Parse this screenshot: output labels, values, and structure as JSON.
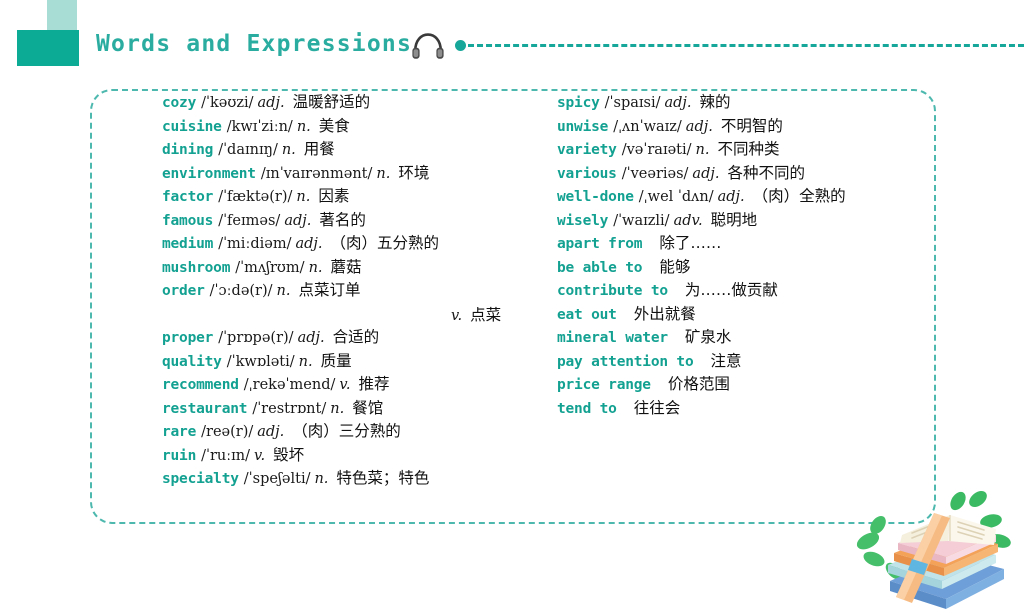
{
  "header": {
    "title": "Words and Expressions",
    "audio_icon": "headphone-icon",
    "accent_color": "#0bab96",
    "accent_light_color": "#a8ddd5",
    "title_color": "#2aada0",
    "trail_color": "#16a79a"
  },
  "panel": {
    "border_color": "#4cb8ae",
    "border_style": "dashed"
  },
  "word_color": "#13a192",
  "columns": {
    "left": [
      {
        "word": "cozy",
        "ipa": "/ˈkəʊzi/",
        "pos": "adj.",
        "cn": "温暖舒适的"
      },
      {
        "word": "cuisine",
        "ipa": "/kwɪˈziːn/",
        "pos": "n.",
        "cn": "美食"
      },
      {
        "word": "dining",
        "ipa": "/ˈdaɪnɪŋ/",
        "pos": "n.",
        "cn": "用餐"
      },
      {
        "word": "environment",
        "ipa": "/ɪnˈvaɪrənmənt/",
        "pos": "n.",
        "cn": "环境"
      },
      {
        "word": "factor",
        "ipa": "/ˈfæktə(r)/",
        "pos": "n.",
        "cn": "因素"
      },
      {
        "word": "famous",
        "ipa": "/ˈfeɪməs/",
        "pos": "adj.",
        "cn": "著名的"
      },
      {
        "word": "medium",
        "ipa": "/ˈmiːdiəm/",
        "pos": "adj.",
        "cn": "（肉）五分熟的"
      },
      {
        "word": "mushroom",
        "ipa": "/ˈmʌʃrʊm/",
        "pos": "n.",
        "cn": "蘑菇"
      },
      {
        "word": "order",
        "ipa": "/ˈɔːdə(r)/",
        "pos": "n.",
        "cn": "点菜订单"
      },
      {
        "word": "",
        "ipa": "",
        "pos": "",
        "cn": ""
      },
      {
        "word": "proper",
        "ipa": "/ˈprɒpə(r)/",
        "pos": "adj.",
        "cn": "合适的"
      },
      {
        "word": "quality",
        "ipa": "/ˈkwɒləti/",
        "pos": "n.",
        "cn": "质量"
      },
      {
        "word": "recommend",
        "ipa": "/ˌrekəˈmend/",
        "pos": "v.",
        "cn": "推荐"
      },
      {
        "word": "restaurant",
        "ipa": "/ˈrestrɒnt/",
        "pos": "n.",
        "cn": "餐馆"
      },
      {
        "word": "rare",
        "ipa": "/reə(r)/",
        "pos": "adj.",
        "cn": "（肉）三分熟的"
      },
      {
        "word": "ruin",
        "ipa": "/ˈruːɪn/",
        "pos": "v.",
        "cn": "毁坏"
      },
      {
        "word": "specialty",
        "ipa": "/ˈspeʃəlti/",
        "pos": "n.",
        "cn": "特色菜；特色"
      }
    ],
    "right": [
      {
        "word": "spicy",
        "ipa": "/ˈspaɪsi/",
        "pos": "adj.",
        "cn": "辣的"
      },
      {
        "word": "unwise",
        "ipa": "/ˌʌnˈwaɪz/",
        "pos": "adj.",
        "cn": "不明智的"
      },
      {
        "word": "variety",
        "ipa": "/vəˈraɪəti/",
        "pos": "n.",
        "cn": "不同种类"
      },
      {
        "word": "various",
        "ipa": "/ˈveəriəs/",
        "pos": "adj.",
        "cn": "各种不同的"
      },
      {
        "word": "well-done",
        "ipa": "/ˌwel ˈdʌn/",
        "pos": "adj.",
        "cn": "（肉）全熟的"
      },
      {
        "word": "wisely",
        "ipa": "/ˈwaɪzli/",
        "pos": "adv.",
        "cn": "聪明地"
      },
      {
        "word": "apart from",
        "ipa": "",
        "pos": "",
        "cn": "除了……"
      },
      {
        "word": "be able to",
        "ipa": "",
        "pos": "",
        "cn": "能够"
      },
      {
        "word": "contribute to",
        "ipa": "",
        "pos": "",
        "cn": "为……做贡献"
      },
      {
        "word": "eat out",
        "ipa": "",
        "pos": "",
        "cn": "外出就餐"
      },
      {
        "word": "mineral water",
        "ipa": "",
        "pos": "",
        "cn": "矿泉水"
      },
      {
        "word": "pay attention to",
        "ipa": "",
        "pos": "",
        "cn": "注意"
      },
      {
        "word": "price range",
        "ipa": "",
        "pos": "",
        "cn": "价格范围"
      },
      {
        "word": "tend to",
        "ipa": "",
        "pos": "",
        "cn": "往往会"
      }
    ]
  },
  "order_continuation": {
    "pos": "v.",
    "cn": "点菜"
  },
  "illustration": {
    "name": "stacked-books-illustration"
  }
}
